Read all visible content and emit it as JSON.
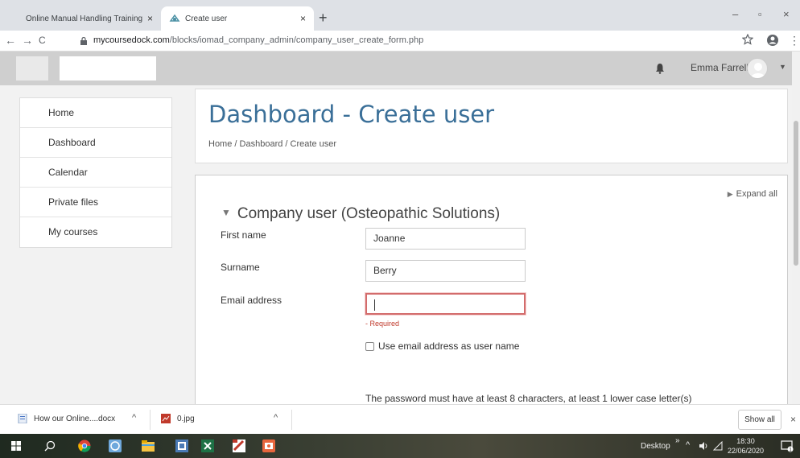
{
  "browser": {
    "tabs": [
      {
        "title": "Online Manual Handling Training",
        "close": "×"
      },
      {
        "title": "Create user",
        "close": "×"
      }
    ],
    "new_tab": "+",
    "window_controls": {
      "minimize": "–",
      "restore": "▫",
      "close": "×"
    },
    "url_domain": "mycoursedock.com",
    "url_path": "/blocks/iomad_company_admin/company_user_create_form.php",
    "nav_back": "←",
    "nav_forward": "→",
    "nav_reload": "C",
    "bookmark_icon": "star-icon",
    "account_icon": "account-icon",
    "menu_icon": "more-icon"
  },
  "navbar": {
    "user_name": "Emma Farrell",
    "icons": [
      "bell-icon",
      "avatar",
      "caret-down-icon"
    ]
  },
  "sidebar": {
    "items": [
      {
        "label": "Home"
      },
      {
        "label": "Dashboard"
      },
      {
        "label": "Calendar"
      },
      {
        "label": "Private files"
      },
      {
        "label": "My courses"
      }
    ]
  },
  "header": {
    "title": "Dashboard - Create user",
    "breadcrumb": [
      "Home",
      "Dashboard",
      "Create user"
    ],
    "separator": "/"
  },
  "form": {
    "expand_all": "Expand all",
    "legend": "Company user (Osteopathic Solutions)",
    "fields": {
      "first_name": {
        "label": "First name",
        "value": "Joanne"
      },
      "surname": {
        "label": "Surname",
        "value": "Berry"
      },
      "email": {
        "label": "Email address",
        "value": "",
        "error": "- Required"
      }
    },
    "use_email_checkbox": {
      "label": "Use email address as user name",
      "checked": false
    },
    "password_note": "The password must have at least 8 characters, at least 1 lower case letter(s)"
  },
  "downloads": {
    "items": [
      {
        "name": "How our Online....docx",
        "icon": "word-doc-icon"
      },
      {
        "name": "0.jpg",
        "icon": "image-file-icon"
      }
    ],
    "show_all": "Show all",
    "close": "×"
  },
  "taskbar": {
    "desktop_label": "Desktop",
    "chevron": "»",
    "time": "18:30",
    "date": "22/06/2020",
    "notification_count": "1"
  },
  "colors": {
    "title": "#3a6f98",
    "error_border": "#d36c6c",
    "error_text": "#c0392b",
    "navbar": "#cfcfcf"
  }
}
